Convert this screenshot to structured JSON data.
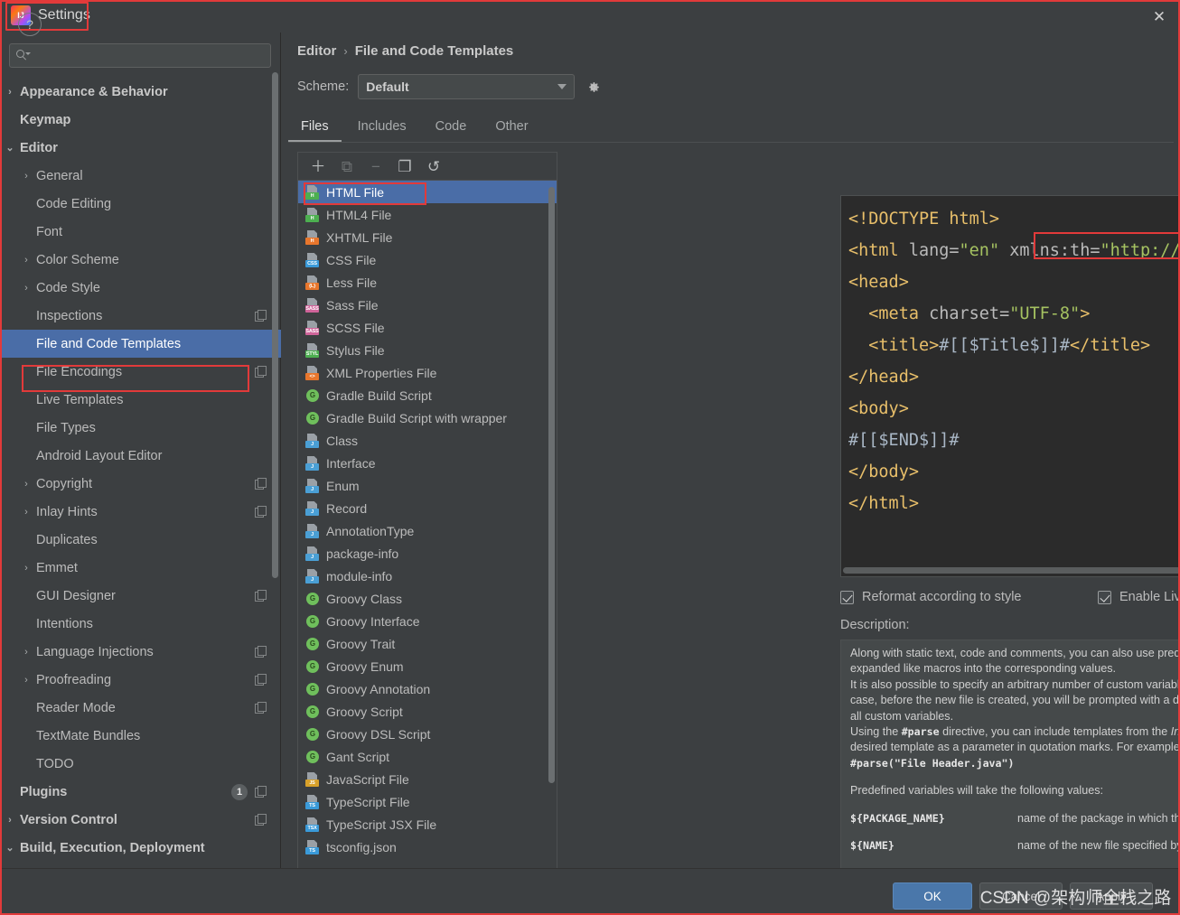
{
  "window": {
    "title": "Settings",
    "app_icon": "intellij-idea-icon",
    "close_label": "✕"
  },
  "search": {
    "value": "",
    "placeholder": ""
  },
  "sidebar": {
    "items": [
      {
        "label": "Appearance & Behavior",
        "level": 0,
        "arrow": "›",
        "bold": true,
        "badge": "",
        "copy": false
      },
      {
        "label": "Keymap",
        "level": 0,
        "arrow": "",
        "bold": true,
        "badge": "",
        "copy": false
      },
      {
        "label": "Editor",
        "level": 0,
        "arrow": "⌄",
        "bold": true,
        "badge": "",
        "copy": false
      },
      {
        "label": "General",
        "level": 1,
        "arrow": "›",
        "bold": false,
        "badge": "",
        "copy": false
      },
      {
        "label": "Code Editing",
        "level": 1,
        "arrow": "",
        "bold": false,
        "badge": "",
        "copy": false
      },
      {
        "label": "Font",
        "level": 1,
        "arrow": "",
        "bold": false,
        "badge": "",
        "copy": false
      },
      {
        "label": "Color Scheme",
        "level": 1,
        "arrow": "›",
        "bold": false,
        "badge": "",
        "copy": false
      },
      {
        "label": "Code Style",
        "level": 1,
        "arrow": "›",
        "bold": false,
        "badge": "",
        "copy": false
      },
      {
        "label": "Inspections",
        "level": 1,
        "arrow": "",
        "bold": false,
        "badge": "",
        "copy": true
      },
      {
        "label": "File and Code Templates",
        "level": 1,
        "arrow": "",
        "bold": false,
        "badge": "",
        "copy": false,
        "selected": true
      },
      {
        "label": "File Encodings",
        "level": 1,
        "arrow": "",
        "bold": false,
        "badge": "",
        "copy": true
      },
      {
        "label": "Live Templates",
        "level": 1,
        "arrow": "",
        "bold": false,
        "badge": "",
        "copy": false
      },
      {
        "label": "File Types",
        "level": 1,
        "arrow": "",
        "bold": false,
        "badge": "",
        "copy": false
      },
      {
        "label": "Android Layout Editor",
        "level": 1,
        "arrow": "",
        "bold": false,
        "badge": "",
        "copy": false
      },
      {
        "label": "Copyright",
        "level": 1,
        "arrow": "›",
        "bold": false,
        "badge": "",
        "copy": true
      },
      {
        "label": "Inlay Hints",
        "level": 1,
        "arrow": "›",
        "bold": false,
        "badge": "",
        "copy": true
      },
      {
        "label": "Duplicates",
        "level": 1,
        "arrow": "",
        "bold": false,
        "badge": "",
        "copy": false
      },
      {
        "label": "Emmet",
        "level": 1,
        "arrow": "›",
        "bold": false,
        "badge": "",
        "copy": false
      },
      {
        "label": "GUI Designer",
        "level": 1,
        "arrow": "",
        "bold": false,
        "badge": "",
        "copy": true
      },
      {
        "label": "Intentions",
        "level": 1,
        "arrow": "",
        "bold": false,
        "badge": "",
        "copy": false
      },
      {
        "label": "Language Injections",
        "level": 1,
        "arrow": "›",
        "bold": false,
        "badge": "",
        "copy": true
      },
      {
        "label": "Proofreading",
        "level": 1,
        "arrow": "›",
        "bold": false,
        "badge": "",
        "copy": true
      },
      {
        "label": "Reader Mode",
        "level": 1,
        "arrow": "",
        "bold": false,
        "badge": "",
        "copy": true
      },
      {
        "label": "TextMate Bundles",
        "level": 1,
        "arrow": "",
        "bold": false,
        "badge": "",
        "copy": false
      },
      {
        "label": "TODO",
        "level": 1,
        "arrow": "",
        "bold": false,
        "badge": "",
        "copy": false
      },
      {
        "label": "Plugins",
        "level": 0,
        "arrow": "",
        "bold": true,
        "badge": "1",
        "copy": true
      },
      {
        "label": "Version Control",
        "level": 0,
        "arrow": "›",
        "bold": true,
        "badge": "",
        "copy": true
      },
      {
        "label": "Build, Execution, Deployment",
        "level": 0,
        "arrow": "⌄",
        "bold": true,
        "badge": "",
        "copy": false
      }
    ]
  },
  "breadcrumb": {
    "parent": "Editor",
    "separator": "›",
    "current": "File and Code Templates"
  },
  "scheme": {
    "label": "Scheme:",
    "value": "Default",
    "gear_icon": "gear-icon"
  },
  "tabs": [
    {
      "label": "Files",
      "active": true
    },
    {
      "label": "Includes",
      "active": false
    },
    {
      "label": "Code",
      "active": false
    },
    {
      "label": "Other",
      "active": false
    }
  ],
  "list_toolbar": [
    {
      "icon": "plus-icon",
      "glyph": "＋",
      "enabled": true
    },
    {
      "icon": "add-file-icon",
      "glyph": "⧉",
      "enabled": false
    },
    {
      "icon": "minus-icon",
      "glyph": "−",
      "enabled": false
    },
    {
      "icon": "copy-icon",
      "glyph": "❐",
      "enabled": true
    },
    {
      "icon": "reset-icon",
      "glyph": "↺",
      "enabled": true
    }
  ],
  "templates": [
    {
      "name": "HTML File",
      "icon": "html-file-icon",
      "kind": "page",
      "tag": "H",
      "color": "#4caf50",
      "selected": true
    },
    {
      "name": "HTML4 File",
      "icon": "html4-file-icon",
      "kind": "page",
      "tag": "H",
      "color": "#4caf50"
    },
    {
      "name": "XHTML File",
      "icon": "xhtml-file-icon",
      "kind": "page",
      "tag": "H",
      "color": "#e8762c"
    },
    {
      "name": "CSS File",
      "icon": "css-file-icon",
      "kind": "page",
      "tag": "CSS",
      "color": "#3a9ad9"
    },
    {
      "name": "Less File",
      "icon": "less-file-icon",
      "kind": "page",
      "tag": "{L}",
      "color": "#e8762c"
    },
    {
      "name": "Sass File",
      "icon": "sass-file-icon",
      "kind": "page",
      "tag": "SASS",
      "color": "#cf649a"
    },
    {
      "name": "SCSS File",
      "icon": "scss-file-icon",
      "kind": "page",
      "tag": "SASS",
      "color": "#cf649a"
    },
    {
      "name": "Stylus File",
      "icon": "stylus-file-icon",
      "kind": "page",
      "tag": "STYL",
      "color": "#4caf50"
    },
    {
      "name": "XML Properties File",
      "icon": "xml-properties-file-icon",
      "kind": "page",
      "tag": "<>",
      "color": "#e8762c"
    },
    {
      "name": "Gradle Build Script",
      "icon": "gradle-icon",
      "kind": "circle",
      "tag": "G",
      "color": "#6fbf5c"
    },
    {
      "name": "Gradle Build Script with wrapper",
      "icon": "gradle-wrapper-icon",
      "kind": "circle",
      "tag": "G",
      "color": "#6fbf5c"
    },
    {
      "name": "Class",
      "icon": "java-class-icon",
      "kind": "page",
      "tag": "J",
      "color": "#4a9fd5"
    },
    {
      "name": "Interface",
      "icon": "java-interface-icon",
      "kind": "page",
      "tag": "J",
      "color": "#4a9fd5"
    },
    {
      "name": "Enum",
      "icon": "java-enum-icon",
      "kind": "page",
      "tag": "J",
      "color": "#4a9fd5"
    },
    {
      "name": "Record",
      "icon": "java-record-icon",
      "kind": "page",
      "tag": "J",
      "color": "#4a9fd5"
    },
    {
      "name": "AnnotationType",
      "icon": "java-annotation-icon",
      "kind": "page",
      "tag": "J",
      "color": "#4a9fd5"
    },
    {
      "name": "package-info",
      "icon": "package-info-icon",
      "kind": "page",
      "tag": "J",
      "color": "#4a9fd5"
    },
    {
      "name": "module-info",
      "icon": "module-info-icon",
      "kind": "page",
      "tag": "J",
      "color": "#4a9fd5"
    },
    {
      "name": "Groovy Class",
      "icon": "groovy-class-icon",
      "kind": "circle",
      "tag": "G",
      "color": "#6fbf5c"
    },
    {
      "name": "Groovy Interface",
      "icon": "groovy-interface-icon",
      "kind": "circle",
      "tag": "G",
      "color": "#6fbf5c"
    },
    {
      "name": "Groovy Trait",
      "icon": "groovy-trait-icon",
      "kind": "circle",
      "tag": "G",
      "color": "#6fbf5c"
    },
    {
      "name": "Groovy Enum",
      "icon": "groovy-enum-icon",
      "kind": "circle",
      "tag": "G",
      "color": "#6fbf5c"
    },
    {
      "name": "Groovy Annotation",
      "icon": "groovy-annotation-icon",
      "kind": "circle",
      "tag": "G",
      "color": "#6fbf5c"
    },
    {
      "name": "Groovy Script",
      "icon": "groovy-script-icon",
      "kind": "circle",
      "tag": "G",
      "color": "#6fbf5c"
    },
    {
      "name": "Groovy DSL Script",
      "icon": "groovy-dsl-script-icon",
      "kind": "circle",
      "tag": "G",
      "color": "#6fbf5c"
    },
    {
      "name": "Gant Script",
      "icon": "gant-script-icon",
      "kind": "circle",
      "tag": "G",
      "color": "#6fbf5c"
    },
    {
      "name": "JavaScript File",
      "icon": "javascript-file-icon",
      "kind": "page",
      "tag": "JS",
      "color": "#d8a12a"
    },
    {
      "name": "TypeScript File",
      "icon": "typescript-file-icon",
      "kind": "page",
      "tag": "TS",
      "color": "#3a9ad9"
    },
    {
      "name": "TypeScript JSX File",
      "icon": "typescript-jsx-file-icon",
      "kind": "page",
      "tag": "TSX",
      "color": "#3a9ad9"
    },
    {
      "name": "tsconfig.json",
      "icon": "tsconfig-json-icon",
      "kind": "page",
      "tag": "TS",
      "color": "#3a9ad9"
    }
  ],
  "editor": {
    "lines": [
      [
        {
          "t": "<!DOCTYPE html>",
          "c": "tag"
        }
      ],
      [
        {
          "t": "<html",
          "c": "tag"
        },
        {
          "t": " lang=",
          "c": "attr"
        },
        {
          "t": "\"en\"",
          "c": "val"
        },
        {
          "t": " xmlns:th=",
          "c": "attr"
        },
        {
          "t": "\"http://www.thymeleaf.o",
          "c": "val"
        }
      ],
      [
        {
          "t": "<head>",
          "c": "tag"
        }
      ],
      [
        {
          "t": "  <meta",
          "c": "tag"
        },
        {
          "t": " charset=",
          "c": "attr"
        },
        {
          "t": "\"UTF-8\"",
          "c": "val"
        },
        {
          "t": ">",
          "c": "tag"
        }
      ],
      [
        {
          "t": "  <title>",
          "c": "tag"
        },
        {
          "t": "#[[$Title$]]#",
          "c": "txt"
        },
        {
          "t": "</title>",
          "c": "tag"
        }
      ],
      [
        {
          "t": "</head>",
          "c": "tag"
        }
      ],
      [
        {
          "t": "<body>",
          "c": "tag"
        }
      ],
      [
        {
          "t": "#[[$END$]]#",
          "c": "txt"
        }
      ],
      [
        {
          "t": "</body>",
          "c": "tag"
        }
      ],
      [
        {
          "t": "</html>",
          "c": "tag"
        }
      ]
    ]
  },
  "options": {
    "reformat": {
      "label": "Reformat according to style",
      "checked": true
    },
    "live_templates": {
      "label": "Enable Live Templates",
      "checked": true
    }
  },
  "description": {
    "label": "Description:",
    "paragraphs": [
      "Along with static text, code and comments, you can also use predefined variables (listed below) that will then be expanded like macros into the corresponding values.",
      "It is also possible to specify an arbitrary number of custom variables in the format ${<VARIABLE_NAME>}. In this case, before the new file is created, you will be prompted with a dialog where you can define particular values for all custom variables.",
      "Using the #parse directive, you can include templates from the Includes tab, by specifying the full name of the desired template as a parameter in quotation marks. For example:",
      "#parse(\"File Header.java\")"
    ],
    "variables_intro": "Predefined variables will take the following values:",
    "variables": [
      {
        "name": "${PACKAGE_NAME}",
        "desc": "name of the package in which the new file is created"
      },
      {
        "name": "${NAME}",
        "desc": "name of the new file specified by you in the New <TEMPLATE_NAME> dialog"
      }
    ]
  },
  "footer": {
    "help_label": "?",
    "ok_label": "OK",
    "cancel_label": "Cancel",
    "apply_label": "Apply",
    "watermark": "CSDN @架构师全栈之路"
  },
  "colors": {
    "window_bg": "#3c3f41",
    "selection_blue": "#4a6da7",
    "highlight_red": "#e23a3a",
    "editor_bg": "#2b2b2b",
    "ok_button": "#4a77aa"
  }
}
